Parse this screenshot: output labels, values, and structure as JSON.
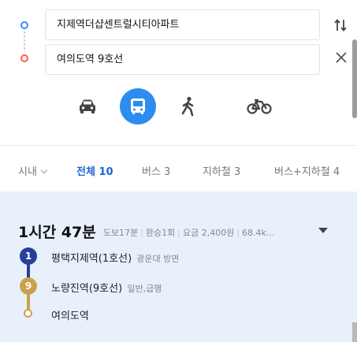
{
  "route": {
    "origin": "지제역더샵센트럴시티아파트",
    "destination": "여의도역 9호선"
  },
  "modes": [
    {
      "name": "car-icon",
      "active": false
    },
    {
      "name": "bus-icon",
      "active": true
    },
    {
      "name": "walk-icon",
      "active": false
    },
    {
      "name": "bike-icon",
      "active": false
    }
  ],
  "filters": {
    "region": "시내",
    "tabs": [
      "전체 10",
      "버스 3",
      "지하철 3",
      "버스+지하철 4"
    ]
  },
  "result": {
    "duration": "1시간 47분",
    "walk": "도보17분",
    "transfer": "환승1회",
    "fare": "요금 2,400원",
    "distance": "68.4k...",
    "steps": [
      {
        "badge": "1",
        "station": "평택지제역(1호선)",
        "detail": "광운대 방면",
        "color": "#263f9a"
      },
      {
        "badge": "9",
        "station": "노량진역(9호선)",
        "detail": "일반,급행",
        "color": "#cba249"
      },
      {
        "station": "여의도역"
      }
    ]
  },
  "colors": {
    "accent": "#2d8cf0",
    "active_tab": "#1b64da",
    "line1": "#263f9a",
    "line9": "#cba249",
    "result_bg": "#e8f1fb"
  }
}
